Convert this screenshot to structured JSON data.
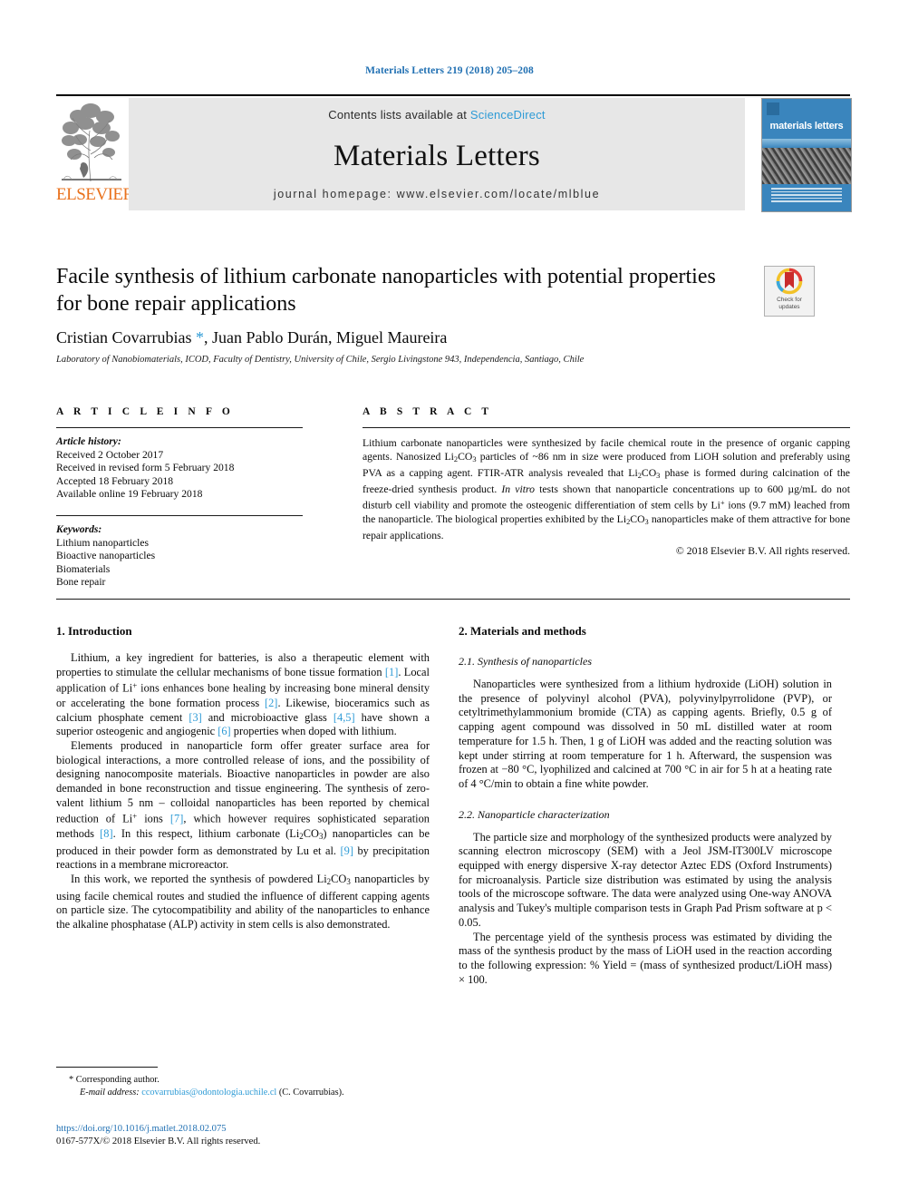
{
  "running_head": "Materials Letters 219 (2018) 205–208",
  "masthead": {
    "contents_prefix": "Contents lists available at ",
    "sciencedirect": "ScienceDirect",
    "journal_title": "Materials Letters",
    "homepage": "journal homepage: www.elsevier.com/locate/mlblue",
    "publisher": "ELSEVIER",
    "cover_title": "materials letters",
    "accent_color": "#2e9bd6",
    "publisher_color": "#E9711C",
    "cover_color": "#3a85bd"
  },
  "title_block": {
    "title": "Facile synthesis of lithium carbonate nanoparticles with potential properties for bone repair applications",
    "authors_part1": "Cristian Covarrubias ",
    "authors_star": "*",
    "authors_part2": ", Juan Pablo Durán, Miguel Maureira",
    "affiliation": "Laboratory of Nanobiomaterials, ICOD, Faculty of Dentistry, University of Chile, Sergio Livingstone 943, Independencia, Santiago, Chile",
    "crossmark_line1": "Check for",
    "crossmark_line2": "updates"
  },
  "article_info": {
    "heading": "A R T I C L E   I N F O",
    "history_label": "Article history:",
    "history": [
      "Received 2 October 2017",
      "Received in revised form 5 February 2018",
      "Accepted 18 February 2018",
      "Available online 19 February 2018"
    ],
    "keywords_label": "Keywords:",
    "keywords": [
      "Lithium nanoparticles",
      "Bioactive nanoparticles",
      "Biomaterials",
      "Bone repair"
    ]
  },
  "abstract": {
    "heading": "A B S T R A C T",
    "text": "Lithium carbonate nanoparticles were synthesized by facile chemical route in the presence of organic capping agents. Nanosized Li2CO3 particles of ~86 nm in size were produced from LiOH solution and preferably using PVA as a capping agent. FTIR-ATR analysis revealed that Li2CO3 phase is formed during calcination of the freeze-dried synthesis product. In vitro tests shown that nanoparticle concentrations up to 600 µg/mL do not disturb cell viability and promote the osteogenic differentiation of stem cells by Li+ ions (9.7 mM) leached from the nanoparticle. The biological properties exhibited by the Li2CO3 nanoparticles make of them attractive for bone repair applications.",
    "copyright": "© 2018 Elsevier B.V. All rights reserved."
  },
  "sections": {
    "introduction": {
      "heading": "1. Introduction",
      "paragraphs": [
        "Lithium, a key ingredient for batteries, is also a therapeutic element with properties to stimulate the cellular mechanisms of bone tissue formation [1]. Local application of Li+ ions enhances bone healing by increasing bone mineral density or accelerating the bone formation process [2]. Likewise, bioceramics such as calcium phosphate cement [3] and microbioactive glass [4,5] have shown a superior osteogenic and angiogenic [6] properties when doped with lithium.",
        "Elements produced in nanoparticle form offer greater surface area for biological interactions, a more controlled release of ions, and the possibility of designing nanocomposite materials. Bioactive nanoparticles in powder are also demanded in bone reconstruction and tissue engineering. The synthesis of zero-valent lithium 5 nm – colloidal nanoparticles has been reported by chemical reduction of Li+ ions [7], which however requires sophisticated separation methods [8]. In this respect, lithium carbonate (Li2CO3) nanoparticles can be produced in their powder form as demonstrated by Lu et al. [9] by precipitation reactions in a membrane microreactor.",
        "In this work, we reported the synthesis of powdered Li2CO3 nanoparticles by using facile chemical routes and studied the influence of different capping agents on particle size. The cytocompatibility and ability of the nanoparticles to enhance the alkaline phosphatase (ALP) activity in stem cells is also demonstrated."
      ]
    },
    "materials": {
      "heading": "2. Materials and methods",
      "sub1_heading": "2.1. Synthesis of nanoparticles",
      "sub1_paragraph": "Nanoparticles were synthesized from a lithium hydroxide (LiOH) solution in the presence of polyvinyl alcohol (PVA), polyvinylpyrrolidone (PVP), or cetyltrimethylammonium bromide (CTA) as capping agents. Briefly, 0.5 g of capping agent compound was dissolved in 50 mL distilled water at room temperature for 1.5 h. Then, 1 g of LiOH was added and the reacting solution was kept under stirring at room temperature for 1 h. Afterward, the suspension was frozen at −80 °C, lyophilized and calcined at 700 °C in air for 5 h at a heating rate of 4 °C/min to obtain a fine white powder.",
      "sub2_heading": "2.2. Nanoparticle characterization",
      "sub2_paragraphs": [
        "The particle size and morphology of the synthesized products were analyzed by scanning electron microscopy (SEM) with a Jeol JSM-IT300LV microscope equipped with energy dispersive X-ray detector Aztec EDS (Oxford Instruments) for microanalysis. Particle size distribution was estimated by using the analysis tools of the microscope software. The data were analyzed using One-way ANOVA analysis and Tukey's multiple comparison tests in Graph Pad Prism software at p < 0.05.",
        "The percentage yield of the synthesis process was estimated by dividing the mass of the synthesis product by the mass of LiOH used in the reaction according to the following expression: % Yield = (mass of synthesized product/LiOH mass) × 100."
      ]
    }
  },
  "footnote": {
    "corresponding_marker": "*",
    "corresponding_text": "Corresponding author.",
    "email_label": "E-mail address:",
    "email": "ccovarrubias@odontologia.uchile.cl",
    "email_suffix": "(C. Covarrubias)."
  },
  "footer": {
    "doi": "https://doi.org/10.1016/j.matlet.2018.02.075",
    "issn_line": "0167-577X/© 2018 Elsevier B.V. All rights reserved."
  }
}
